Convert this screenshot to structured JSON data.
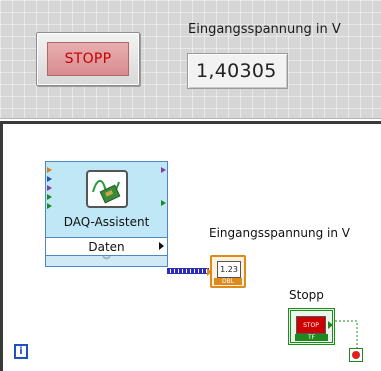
{
  "front_panel": {
    "stop_button_label": "STOPP",
    "indicator_label": "Eingangsspannung in V",
    "indicator_value": "1,40305"
  },
  "block_diagram": {
    "daq_assistant": {
      "title": "DAQ-Assistent",
      "output_label": "Daten"
    },
    "numeric_indicator": {
      "label": "Eingangsspannung in V",
      "display": "1.23",
      "type_tag": "DBL"
    },
    "stop_terminal": {
      "label": "Stopp",
      "button_text": "STOP",
      "type_tag": "TF"
    },
    "iteration_terminal": "i"
  },
  "colors": {
    "wire_dynamic": "#2b2bb8",
    "wire_boolean": "#1e8a1e",
    "numeric_terminal": "#e08a1c",
    "boolean_terminal": "#1e8a1e",
    "express_vi": "#bfe7f6",
    "stop_text": "#c40000",
    "front_panel_bg": "#d6d6d6"
  }
}
